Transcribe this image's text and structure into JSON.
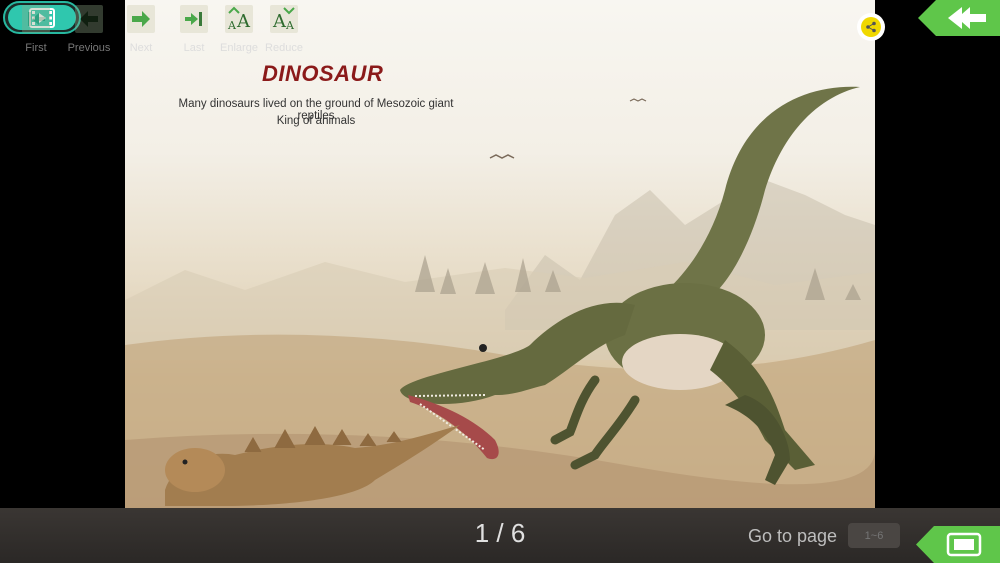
{
  "page": {
    "title": "DINOSAUR",
    "subtitle_line1": "Many dinosaurs lived on the ground of Mesozoic giant reptiles",
    "subtitle_line2": "King of animals"
  },
  "top_controls": {
    "video_icon": "film-play-icon",
    "share_icon": "share-icon",
    "back_icon": "double-arrow-left-icon"
  },
  "toolbar": {
    "buttons": [
      {
        "label": "First",
        "icon": "first-page-icon",
        "enabled": false
      },
      {
        "label": "Previous",
        "icon": "arrow-left-icon",
        "enabled": false
      },
      {
        "label": "Next",
        "icon": "arrow-right-icon",
        "enabled": true
      },
      {
        "label": "Last",
        "icon": "last-page-icon",
        "enabled": true
      },
      {
        "label": "Enlarge",
        "icon": "enlarge-text-icon",
        "enabled": true
      },
      {
        "label": "Reduce",
        "icon": "reduce-text-icon",
        "enabled": true
      }
    ],
    "page_counter": "1 / 6",
    "goto_label": "Go to page",
    "goto_placeholder": "1~6",
    "fullscreen_icon": "fullscreen-icon"
  },
  "colors": {
    "title": "#8b1a1a",
    "accent_green": "#5fc64a",
    "teal": "#2fc7ae",
    "share_yellow": "#f0d800"
  }
}
